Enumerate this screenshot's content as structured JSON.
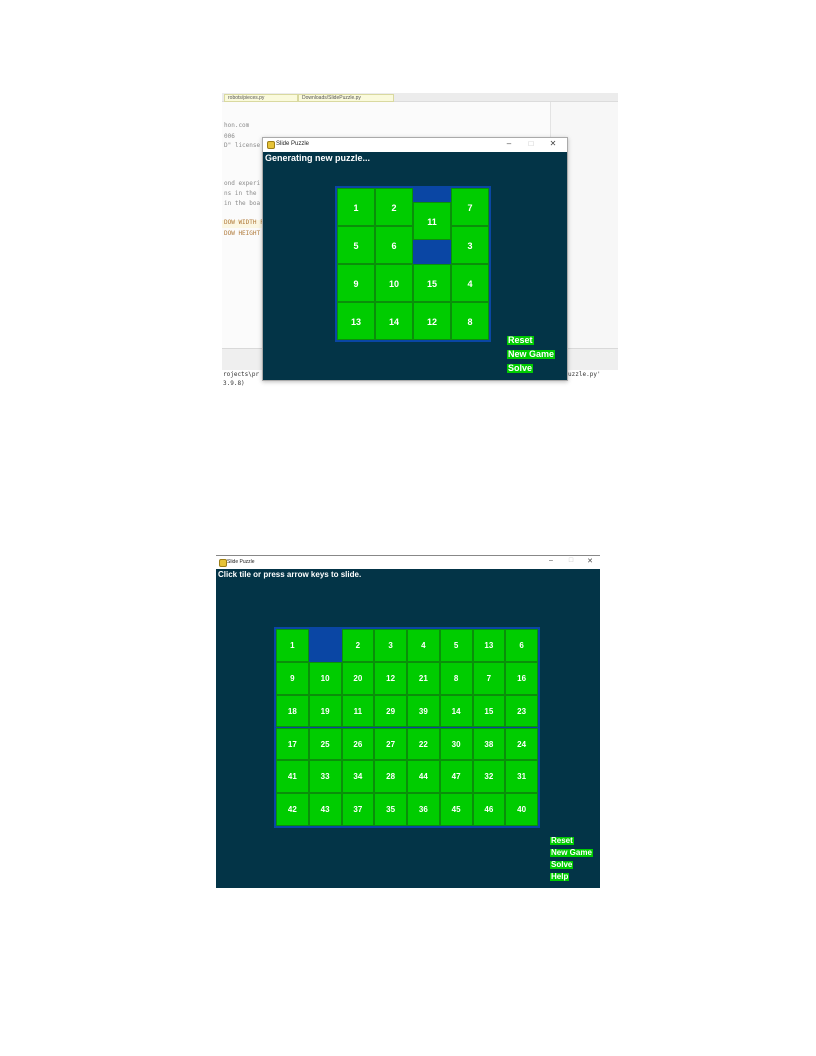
{
  "ide": {
    "tabs": [
      "robots/pieces.py",
      "Downloads/SlidePuzzle.py"
    ],
    "code_lines": [
      "hon.com",
      "006",
      "D\" license",
      "ond experi",
      "ns in the",
      "in the boa",
      "DOW WIDTH F",
      "DOW HEIGHT"
    ],
    "console_lines": [
      "rojects\\pr",
      "lidePuzzle.py'",
      "3.9.8)"
    ]
  },
  "window1": {
    "title": "Slide Puzzle",
    "controls": {
      "minimize": "–",
      "maximize": "□",
      "close": "✕"
    },
    "message": "Generating new puzzle...",
    "board": {
      "cols": 4,
      "rows": 4,
      "tiles": [
        {
          "label": "1",
          "col": 0,
          "row": 0
        },
        {
          "label": "2",
          "col": 1,
          "row": 0
        },
        {
          "label": "11",
          "col": 2,
          "row": 0.38
        },
        {
          "label": "7",
          "col": 3,
          "row": 0
        },
        {
          "label": "5",
          "col": 0,
          "row": 1
        },
        {
          "label": "6",
          "col": 1,
          "row": 1
        },
        {
          "label": "3",
          "col": 3,
          "row": 1
        },
        {
          "label": "9",
          "col": 0,
          "row": 2
        },
        {
          "label": "10",
          "col": 1,
          "row": 2
        },
        {
          "label": "15",
          "col": 2,
          "row": 2
        },
        {
          "label": "4",
          "col": 3,
          "row": 2
        },
        {
          "label": "13",
          "col": 0,
          "row": 3
        },
        {
          "label": "14",
          "col": 1,
          "row": 3
        },
        {
          "label": "12",
          "col": 2,
          "row": 3
        },
        {
          "label": "8",
          "col": 3,
          "row": 3
        }
      ]
    },
    "buttons": [
      "Reset",
      "New Game",
      "Solve"
    ]
  },
  "window2": {
    "title": "Slide Puzzle",
    "controls": {
      "minimize": "–",
      "maximize": "□",
      "close": "✕"
    },
    "message": "Click tile or press arrow keys to slide.",
    "board": {
      "cols": 8,
      "rows": 6,
      "grid": [
        [
          "1",
          "",
          "2",
          "3",
          "4",
          "5",
          "13",
          "6"
        ],
        [
          "9",
          "10",
          "20",
          "12",
          "21",
          "8",
          "7",
          "16"
        ],
        [
          "18",
          "19",
          "11",
          "29",
          "39",
          "14",
          "15",
          "23"
        ],
        [
          "17",
          "25",
          "26",
          "27",
          "22",
          "30",
          "38",
          "24"
        ],
        [
          "41",
          "33",
          "34",
          "28",
          "44",
          "47",
          "32",
          "31"
        ],
        [
          "42",
          "43",
          "37",
          "35",
          "36",
          "45",
          "46",
          "40"
        ]
      ]
    },
    "buttons": [
      "Reset",
      "New Game",
      "Solve",
      "Help"
    ]
  },
  "colors": {
    "background": "#033447",
    "tile": "#00cc00",
    "board_border": "#0a46a4",
    "text": "#ffffff"
  }
}
